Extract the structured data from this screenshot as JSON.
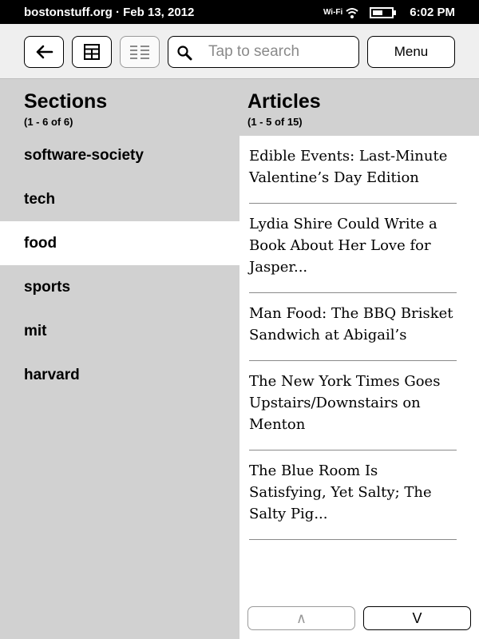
{
  "status_bar": {
    "site_date": "bostonstuff.org · Feb 13, 2012",
    "wifi_label": "Wi-Fi",
    "time": "6:02 PM"
  },
  "toolbar": {
    "back_icon": "back-arrow-icon",
    "grid_icon": "grid-view-icon",
    "list_icon": "list-view-icon",
    "search_placeholder": "Tap to search",
    "menu_label": "Menu"
  },
  "sections": {
    "title": "Sections",
    "count": "(1 - 6 of 6)",
    "items": [
      {
        "label": "software-society",
        "selected": false
      },
      {
        "label": "tech",
        "selected": false
      },
      {
        "label": "food",
        "selected": true
      },
      {
        "label": "sports",
        "selected": false
      },
      {
        "label": "mit",
        "selected": false
      },
      {
        "label": "harvard",
        "selected": false
      }
    ]
  },
  "articles": {
    "title": "Articles",
    "count": "(1 - 5 of 15)",
    "items": [
      "Edible Events: Last-Minute Valentine’s Day Edition",
      "Lydia Shire Could Write a Book About Her Love for Jasper...",
      "Man Food: The BBQ Brisket Sandwich at Abigail’s",
      "The New York Times Goes Upstairs/Downstairs on Menton",
      "The Blue Room Is Satisfying, Yet Salty; The Salty Pig..."
    ]
  },
  "paging": {
    "up_label": "∧",
    "down_label": "V"
  }
}
